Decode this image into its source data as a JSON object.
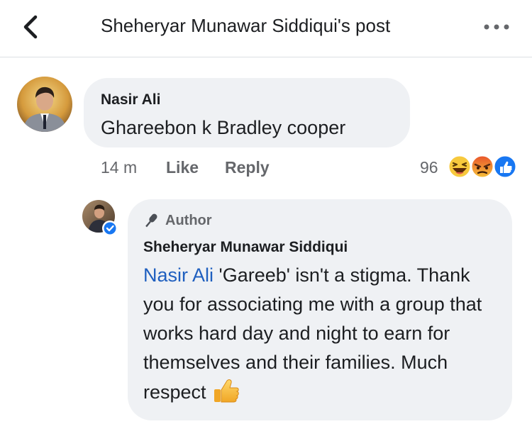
{
  "header": {
    "title": "Sheheryar Munawar Siddiqui's post",
    "back_icon": "chevron-left-icon",
    "more_icon": "more-dots-icon"
  },
  "comment": {
    "author": "Nasir Ali",
    "text": "Ghareebon k Bradley cooper",
    "time": "14 m",
    "like_label": "Like",
    "reply_label": "Reply",
    "reaction_count": "96",
    "reactions": [
      "haha",
      "angry",
      "like"
    ]
  },
  "reply": {
    "badge": "Author",
    "author": "Sheheryar Munawar Siddiqui",
    "mention": "Nasir Ali",
    "text": " 'Gareeb' isn't a stigma. Thank you for associating me with a group that works hard day and night to earn for themselves and their families. Much respect",
    "emoji": "thumbs-up-icon"
  },
  "colors": {
    "bubble": "#eff1f4",
    "mention": "#1f5fbf",
    "meta_text": "#65676b",
    "like_blue": "#1877f2"
  }
}
